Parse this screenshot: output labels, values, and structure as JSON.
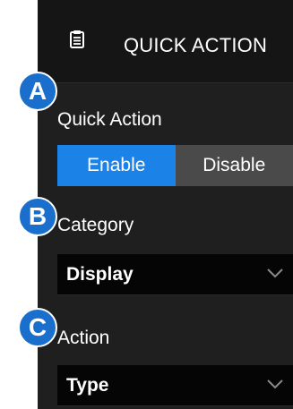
{
  "header": {
    "title": "QUICK ACTION",
    "icon": "clipboard-list-icon"
  },
  "callouts": {
    "a": "A",
    "b": "B",
    "c": "C"
  },
  "quick_action": {
    "label": "Quick Action",
    "options": [
      "Enable",
      "Disable"
    ],
    "selected": "Enable"
  },
  "category": {
    "label": "Category",
    "value": "Display"
  },
  "action": {
    "label": "Action",
    "value": "Type"
  },
  "colors": {
    "accent": "#1b82e8",
    "badge": "#1b6fcc",
    "panel_bg": "#1f1f1f",
    "header_bg": "#151515",
    "dropdown_bg": "#050505",
    "inactive_button": "#4a4a4a"
  }
}
